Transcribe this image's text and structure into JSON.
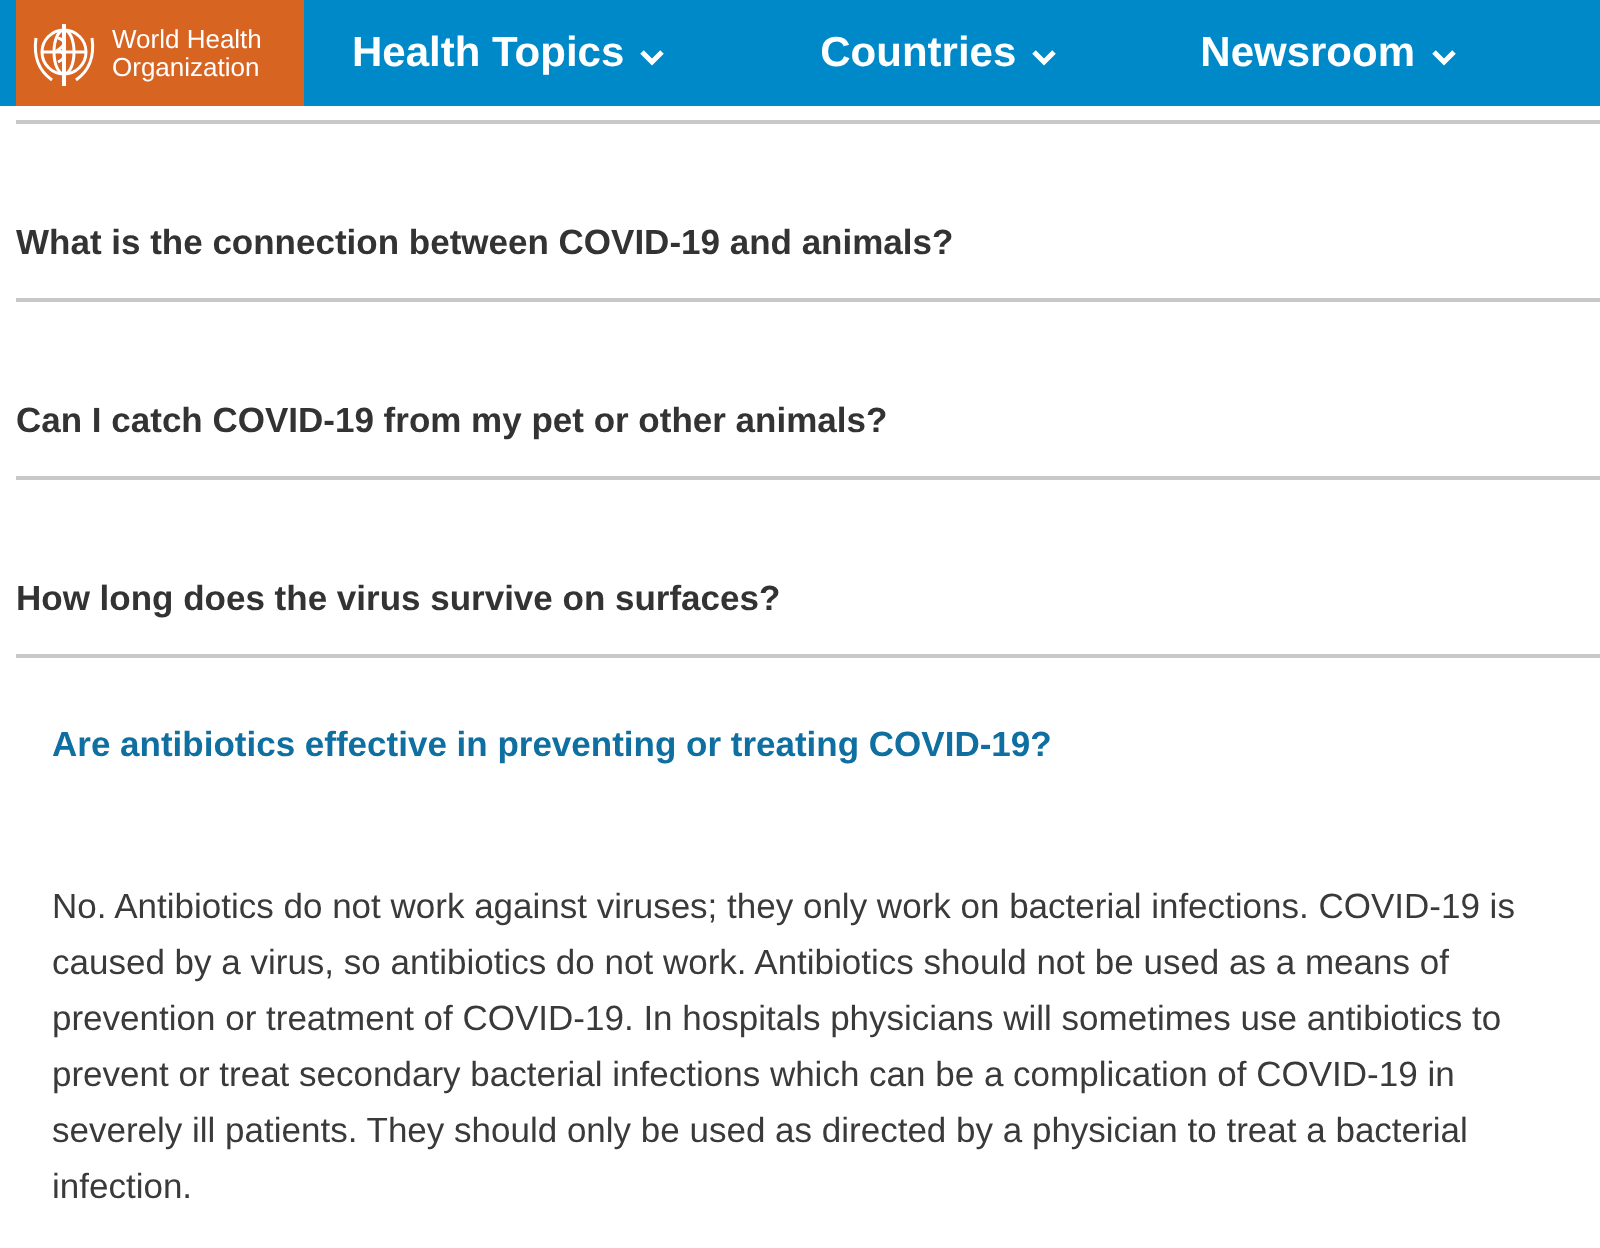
{
  "header": {
    "logo": {
      "line1": "World Health",
      "line2": "Organization"
    },
    "nav": [
      {
        "label": "Health Topics"
      },
      {
        "label": "Countries"
      },
      {
        "label": "Newsroom"
      }
    ]
  },
  "faq": [
    {
      "question": "What is the connection between COVID-19 and animals?",
      "expanded": false
    },
    {
      "question": "Can I catch COVID-19 from my pet or other animals?",
      "expanded": false
    },
    {
      "question": "How long does the virus survive on surfaces?",
      "expanded": false
    },
    {
      "question": "Are antibiotics effective in preventing or treating COVID-19?",
      "expanded": true,
      "answer": "No. Antibiotics do not work against viruses; they only work on bacterial infections. COVID-19 is caused by a virus, so antibiotics do not work. Antibiotics should not be used as a means of prevention or treatment of COVID-19. In hospitals physicians will sometimes use antibiotics to prevent or treat secondary bacterial infections which can be a complication of COVID-19 in severely ill patients. They should only be used as directed by a physician to treat a bacterial infection."
    }
  ]
}
